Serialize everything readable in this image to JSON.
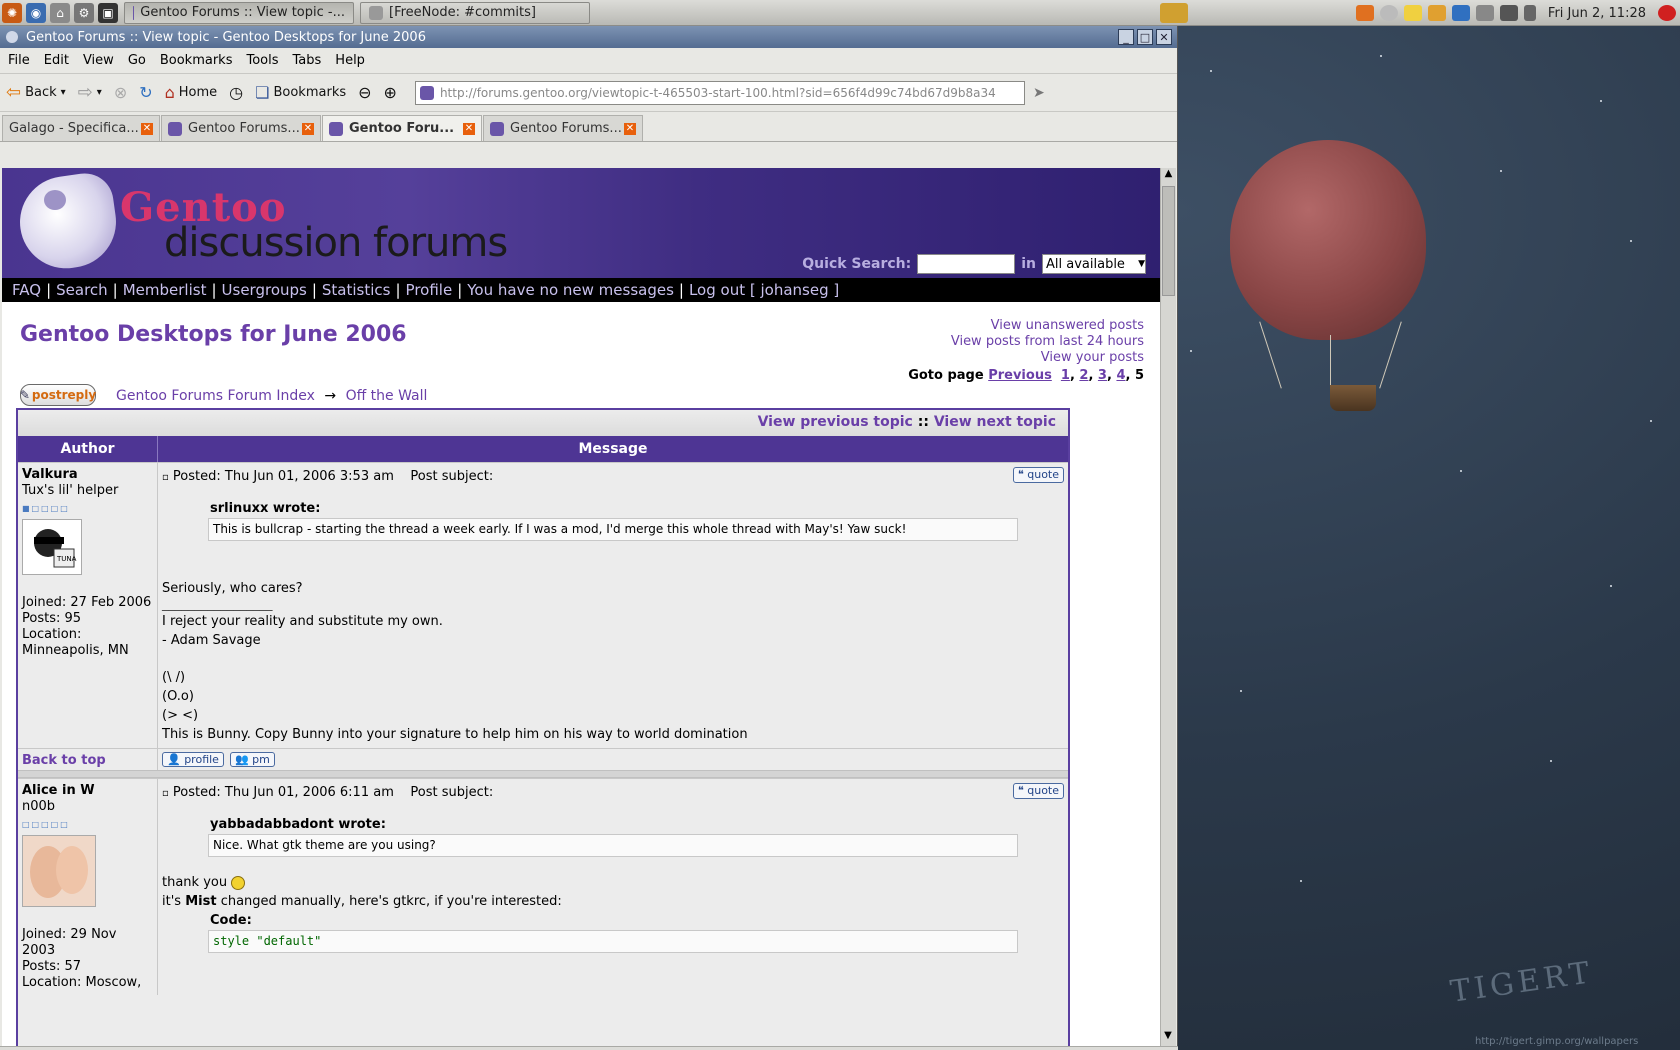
{
  "taskbar": {
    "tasks": [
      {
        "label": "Gentoo Forums :: View topic -..."
      },
      {
        "label": "[FreeNode: #commits]"
      }
    ],
    "clock": "Fri Jun  2, 11:28"
  },
  "window": {
    "title": "Gentoo Forums :: View topic - Gentoo Desktops for June 2006",
    "menu": [
      "File",
      "Edit",
      "View",
      "Go",
      "Bookmarks",
      "Tools",
      "Tabs",
      "Help"
    ],
    "toolbar": {
      "back": "Back",
      "home": "Home",
      "bookmarks": "Bookmarks",
      "url": "http://forums.gentoo.org/viewtopic-t-465503-start-100.html?sid=656f4d99c74bd67d9b8a34"
    },
    "tabs": [
      {
        "label": "Galago - Specifica..."
      },
      {
        "label": "Gentoo Forums..."
      },
      {
        "label": "Gentoo Foru..."
      },
      {
        "label": "Gentoo Forums..."
      }
    ]
  },
  "forum": {
    "logo_top": "Gentoo",
    "logo_bottom": "discussion forums",
    "quick_search_label": "Quick Search:",
    "in_label": "in",
    "search_scope": "All available",
    "nav": [
      "FAQ",
      "Search",
      "Memberlist",
      "Usergroups",
      "Statistics",
      "Profile",
      "You have no new messages",
      "Log out [ johanseg ]"
    ],
    "topic_title": "Gentoo Desktops for June 2006",
    "right_links": [
      "View unanswered posts",
      "View posts from last 24 hours",
      "View your posts"
    ],
    "goto_label": "Goto page",
    "goto_prev": "Previous",
    "pages": [
      "1",
      "2",
      "3",
      "4"
    ],
    "current_page": "5",
    "postreply": "postreply",
    "breadcrumb_index": "Gentoo Forums Forum Index",
    "breadcrumb_arrow": "→",
    "breadcrumb_forum": "Off the Wall",
    "view_prev": "View previous topic",
    "view_sep": "::",
    "view_next": "View next topic",
    "col_author": "Author",
    "col_message": "Message",
    "back_to_top": "Back to top",
    "quote_btn": "quote",
    "profile_btn": "profile",
    "pm_btn": "pm",
    "posts": [
      {
        "author": "Valkura",
        "rank": "Tux's lil' helper",
        "joined": "Joined: 27 Feb 2006",
        "posts": "Posts: 95",
        "location": "Location: Minneapolis, MN",
        "posted": "Posted: Thu Jun 01, 2006 3:53 am",
        "subject": "Post subject:",
        "quote_author": "srlinuxx wrote:",
        "quote_text": "This is bullcrap - starting the thread a week early. If I was a mod, I'd merge this whole thread with May's! Yaw suck!",
        "body": "Seriously, who cares?",
        "sig_line": "_________________",
        "sig": [
          "I reject your reality and substitute my own.",
          "- Adam Savage",
          "",
          "(\\ /)",
          "(O.o)",
          "(> <)",
          "This is Bunny. Copy Bunny into your signature to help him on his way to world domination"
        ]
      },
      {
        "author": "Alice in W",
        "rank": "n00b",
        "joined": "Joined: 29 Nov 2003",
        "posts": "Posts: 57",
        "location": "Location: Moscow,",
        "posted": "Posted: Thu Jun 01, 2006 6:11 am",
        "subject": "Post subject:",
        "quote_author": "yabbadabbadont wrote:",
        "quote_text": "Nice. What gtk theme are you using?",
        "body": "thank you",
        "body2_pre": "it's",
        "body2_bold": "Mist",
        "body2_post": "changed manually, here's gtkrc, if you're interested:",
        "code_label": "Code:",
        "code": "style \"default\""
      }
    ]
  },
  "wallpaper": {
    "signature": "TIGERT",
    "url": "http://tigert.gimp.org/wallpapers"
  }
}
